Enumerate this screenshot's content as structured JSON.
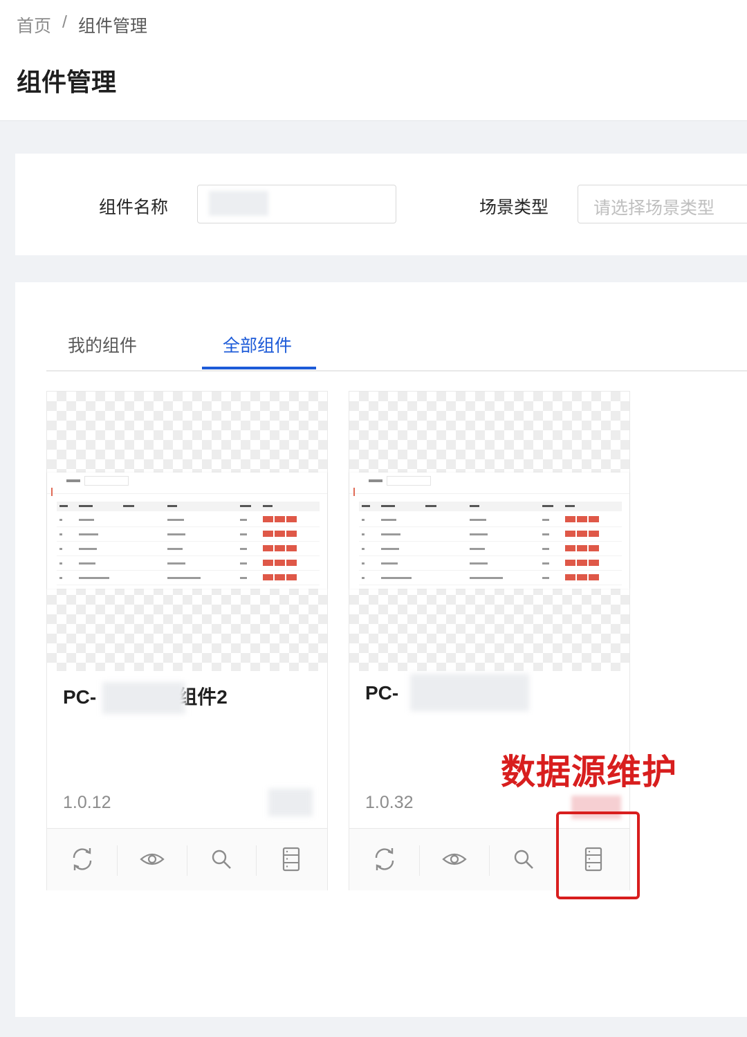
{
  "breadcrumb": {
    "home": "首页",
    "separator": "/",
    "current": "组件管理"
  },
  "page_title": "组件管理",
  "filters": {
    "name_label": "组件名称",
    "name_value": "",
    "scene_label": "场景类型",
    "scene_placeholder": "请选择场景类型"
  },
  "tabs": [
    {
      "label": "我的组件",
      "active": false
    },
    {
      "label": "全部组件",
      "active": true
    }
  ],
  "cards": [
    {
      "title_prefix": "PC-",
      "title_suffix": "组件2",
      "version": "1.0.12"
    },
    {
      "title_prefix": "PC-",
      "title_suffix": "",
      "version": "1.0.32"
    }
  ],
  "card_actions": [
    "refresh-icon",
    "eye-icon",
    "search-icon",
    "database-icon"
  ],
  "annotation": {
    "text": "数据源维护",
    "color": "#d81e1e"
  },
  "colors": {
    "accent": "#1d5bd8",
    "background": "#f0f2f5"
  }
}
